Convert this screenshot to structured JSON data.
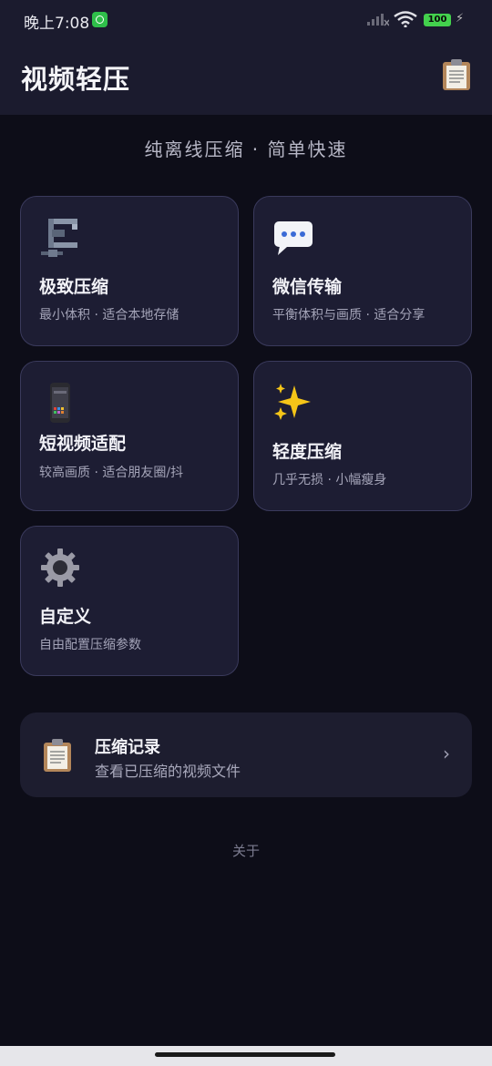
{
  "status_bar": {
    "time": "晚上7:08",
    "battery": "100"
  },
  "header": {
    "title": "视频轻压",
    "clipboard_icon": "clipboard-icon"
  },
  "subtitle": "纯离线压缩 · 简单快速",
  "modes": [
    {
      "title": "极致压缩",
      "desc": "最小体积 · 适合本地存储",
      "icon": "clamp-icon"
    },
    {
      "title": "微信传输",
      "desc": "平衡体积与画质 · 适合分享",
      "icon": "speech-bubble-icon"
    },
    {
      "title": "短视频适配",
      "desc": "较高画质 · 适合朋友圈/抖",
      "icon": "phone-icon"
    },
    {
      "title": "轻度压缩",
      "desc": "几乎无损 · 小幅瘦身",
      "icon": "sparkles-icon"
    },
    {
      "title": "自定义",
      "desc": "自由配置压缩参数",
      "icon": "gear-icon"
    }
  ],
  "history": {
    "title": "压缩记录",
    "subtitle": "查看已压缩的视频文件",
    "arrow": "›"
  },
  "about": "关于"
}
